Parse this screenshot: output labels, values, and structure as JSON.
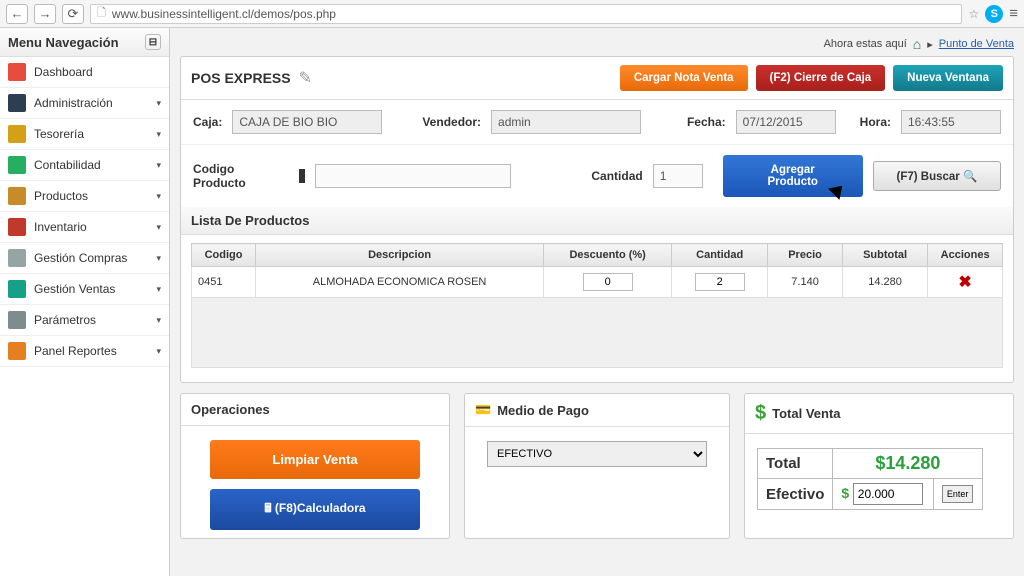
{
  "chrome": {
    "url": "www.businessintelligent.cl/demos/pos.php"
  },
  "sidebar": {
    "title": "Menu Navegación",
    "items": [
      {
        "label": "Dashboard",
        "color": "#e74c3c",
        "caret": false
      },
      {
        "label": "Administración",
        "color": "#2c3e50",
        "caret": true
      },
      {
        "label": "Tesorería",
        "color": "#d4a017",
        "caret": true
      },
      {
        "label": "Contabilidad",
        "color": "#27ae60",
        "caret": true
      },
      {
        "label": "Productos",
        "color": "#c78b2a",
        "caret": true
      },
      {
        "label": "Inventario",
        "color": "#c0392b",
        "caret": true
      },
      {
        "label": "Gestión Compras",
        "color": "#95a5a6",
        "caret": true
      },
      {
        "label": "Gestión Ventas",
        "color": "#16a085",
        "caret": true
      },
      {
        "label": "Parámetros",
        "color": "#7f8c8d",
        "caret": true
      },
      {
        "label": "Panel Reportes",
        "color": "#e67e22",
        "caret": true
      }
    ]
  },
  "breadcrumb": {
    "prefix": "Ahora estas aquí",
    "link": "Punto de Venta"
  },
  "header": {
    "title": "POS EXPRESS",
    "btn_cargar": "Cargar Nota Venta",
    "btn_cierre": "(F2) Cierre de Caja",
    "btn_nueva": "Nueva Ventana"
  },
  "info": {
    "caja_label": "Caja:",
    "caja": "CAJA DE BIO BIO",
    "vend_label": "Vendedor:",
    "vend": "admin",
    "fecha_label": "Fecha:",
    "fecha": "07/12/2015",
    "hora_label": "Hora:",
    "hora": "16:43:55"
  },
  "entry": {
    "code_label": "Codigo Producto",
    "qty_label": "Cantidad",
    "qty_value": "1",
    "btn_add": "Agregar Producto",
    "btn_search": "(F7) Buscar 🔍"
  },
  "products": {
    "section_title": "Lista De Productos",
    "headers": {
      "codigo": "Codigo",
      "desc": "Descripcion",
      "disc": "Descuento (%)",
      "qty": "Cantidad",
      "price": "Precio",
      "subtotal": "Subtotal",
      "actions": "Acciones"
    },
    "rows": [
      {
        "codigo": "0451",
        "desc": "ALMOHADA ECONOMICA ROSEN",
        "disc": "0",
        "qty": "2",
        "price": "7.140",
        "subtotal": "14.280"
      }
    ]
  },
  "ops": {
    "title": "Operaciones",
    "btn_clear": "Limpiar Venta",
    "btn_calc": "🖩  (F8)Calculadora"
  },
  "pay": {
    "title": "Medio de Pago",
    "selected": "EFECTIVO"
  },
  "total": {
    "title": "Total Venta",
    "total_label": "Total",
    "total_value": "$14.280",
    "cash_label": "Efectivo",
    "cash_value": "20.000",
    "enter": "Enter"
  }
}
